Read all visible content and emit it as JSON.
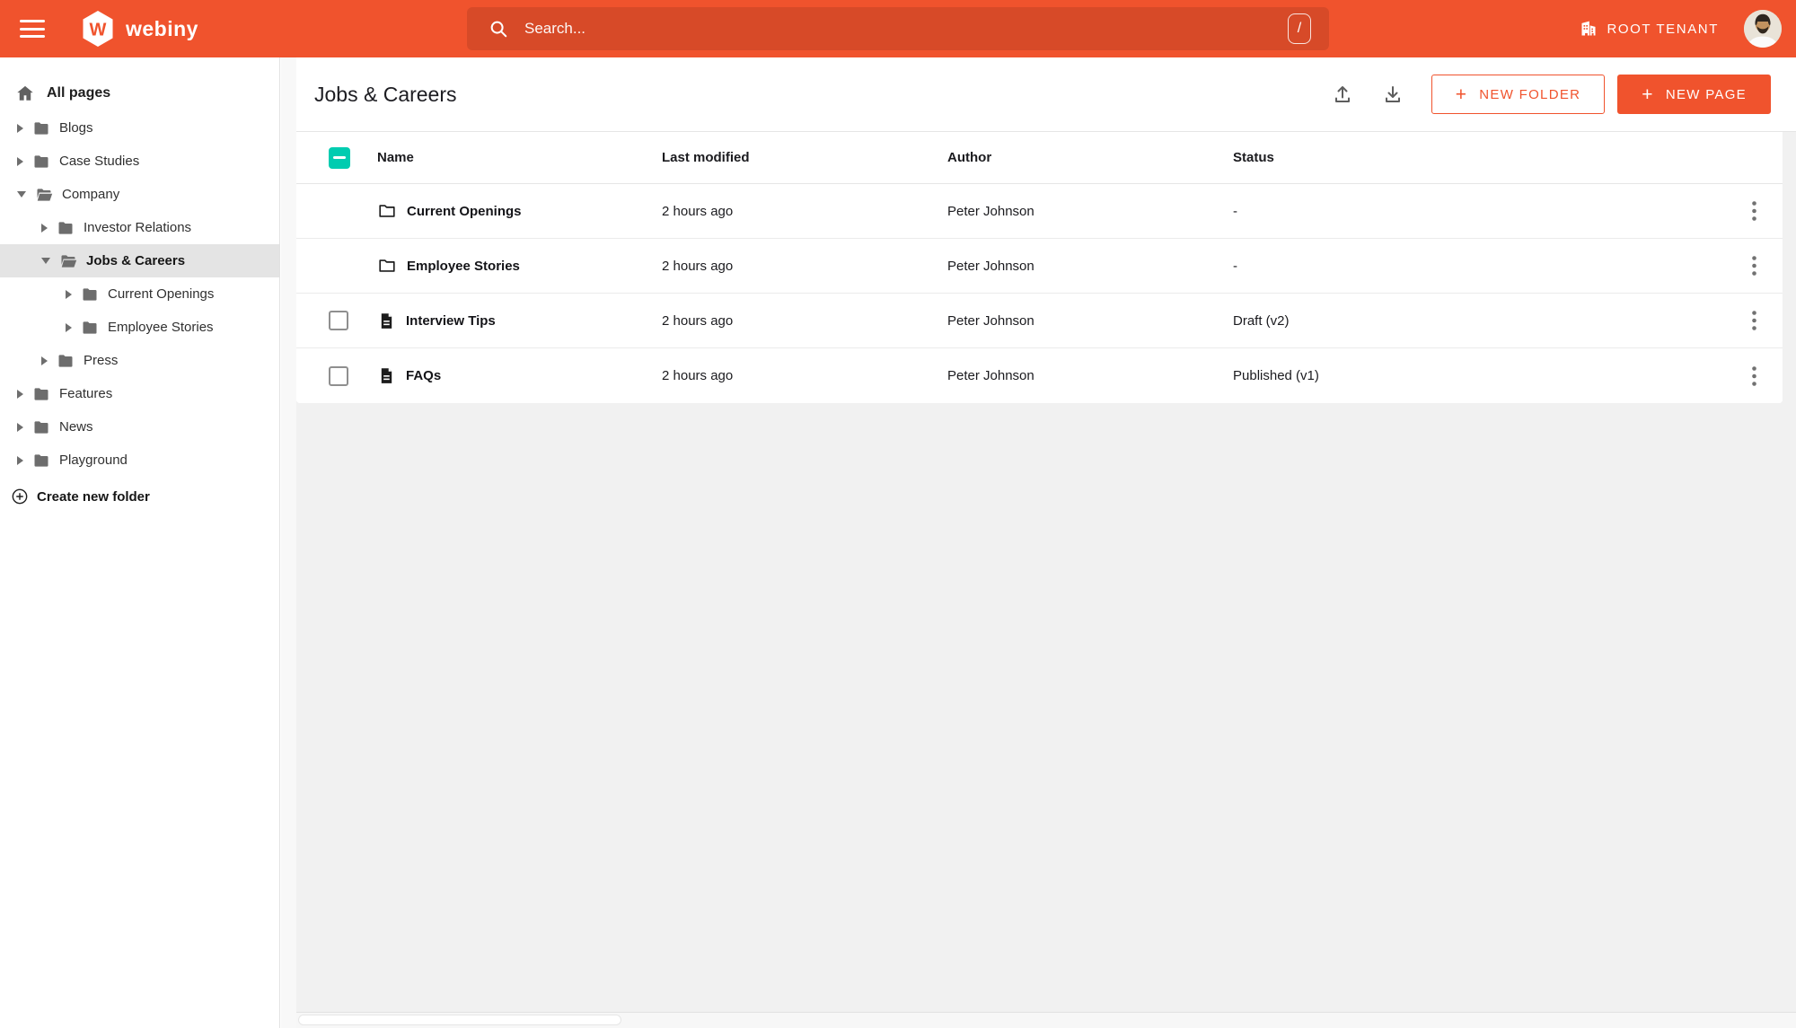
{
  "topbar": {
    "brand": "webiny",
    "search": {
      "placeholder": "Search...",
      "shortcut_key": "/"
    },
    "tenant_label": "ROOT TENANT"
  },
  "sidebar": {
    "root_label": "All pages",
    "create_folder_label": "Create new folder",
    "items": [
      {
        "label": "Blogs",
        "level": 1,
        "state": "collapsed"
      },
      {
        "label": "Case Studies",
        "level": 1,
        "state": "collapsed"
      },
      {
        "label": "Company",
        "level": 1,
        "state": "expanded"
      },
      {
        "label": "Investor Relations",
        "level": 2,
        "state": "collapsed"
      },
      {
        "label": "Jobs & Careers",
        "level": 2,
        "state": "expanded",
        "selected": true
      },
      {
        "label": "Current Openings",
        "level": 3,
        "state": "collapsed"
      },
      {
        "label": "Employee Stories",
        "level": 3,
        "state": "collapsed"
      },
      {
        "label": "Press",
        "level": 2,
        "state": "collapsed"
      },
      {
        "label": "Features",
        "level": 1,
        "state": "collapsed"
      },
      {
        "label": "News",
        "level": 1,
        "state": "collapsed"
      },
      {
        "label": "Playground",
        "level": 1,
        "state": "collapsed"
      }
    ]
  },
  "main": {
    "title": "Jobs & Careers",
    "actions": {
      "new_folder_label": "NEW FOLDER",
      "new_page_label": "NEW PAGE",
      "plus": "+"
    },
    "table": {
      "header_checkbox_state": "indeterminate",
      "columns": {
        "name": "Name",
        "modified": "Last modified",
        "author": "Author",
        "status": "Status"
      },
      "rows": [
        {
          "type": "folder",
          "name": "Current Openings",
          "modified": "2 hours ago",
          "author": "Peter Johnson",
          "status": "-",
          "has_checkbox": false
        },
        {
          "type": "folder",
          "name": "Employee Stories",
          "modified": "2 hours ago",
          "author": "Peter Johnson",
          "status": "-",
          "has_checkbox": false
        },
        {
          "type": "page",
          "name": "Interview Tips",
          "modified": "2 hours ago",
          "author": "Peter Johnson",
          "status": "Draft (v2)",
          "has_checkbox": true
        },
        {
          "type": "page",
          "name": "FAQs",
          "modified": "2 hours ago",
          "author": "Peter Johnson",
          "status": "Published (v1)",
          "has_checkbox": true
        }
      ]
    }
  },
  "icons": {
    "menu-icon": "hamburger three bars",
    "webiny-logo": "white hexagon with orange W",
    "search-icon": "magnifier",
    "slash-shortcut-badge": "/",
    "building-icon": "tenant building",
    "avatar": "user photo",
    "home-icon": "house",
    "folder-icon": "folder",
    "folder-open-icon": "open folder",
    "caret-right-icon": "collapsed triangle",
    "caret-down-icon": "expanded triangle",
    "circle-plus-icon": "create folder plus",
    "upload-icon": "import arrow up from tray",
    "download-icon": "export arrow down to tray",
    "document-icon": "page with lines",
    "kebab-icon": "vertical three dots"
  },
  "colors": {
    "brand_orange": "#f0532d",
    "accent_teal": "#00ccb0",
    "selected_row_gray": "#e4e4e4",
    "content_bg_gray": "#f1f1f1"
  }
}
